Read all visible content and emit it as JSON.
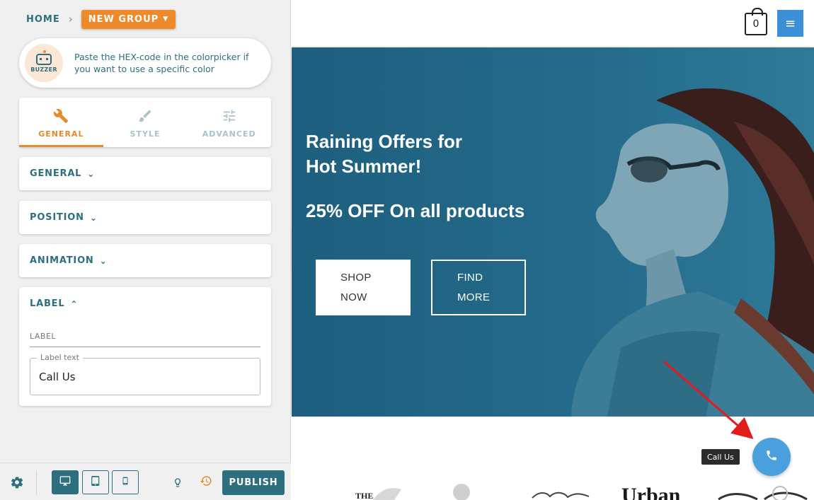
{
  "breadcrumb": {
    "home": "HOME",
    "group": "NEW GROUP"
  },
  "tip": {
    "brand": "BUZZER",
    "text": "Paste the HEX-code in the colorpicker if you want to use a specific color"
  },
  "tabs": [
    {
      "label": "GENERAL",
      "icon": "wrench-icon",
      "active": true
    },
    {
      "label": "STYLE",
      "icon": "brush-icon",
      "active": false
    },
    {
      "label": "ADVANCED",
      "icon": "sliders-icon",
      "active": false
    }
  ],
  "sections": {
    "general": "GENERAL",
    "position": "POSITION",
    "animation": "ANIMATION",
    "label": "LABEL"
  },
  "label_section": {
    "caption": "LABEL",
    "field_legend": "Label text",
    "field_value": "Call Us"
  },
  "footer": {
    "publish": "PUBLISH",
    "active_device": "desktop"
  },
  "site": {
    "cart_count": "0",
    "hero_line1": "Raining Offers for",
    "hero_line2": "Hot Summer!",
    "hero_offer": "25% OFF On all products",
    "btn_shop_1": "SHOP",
    "btn_shop_2": "NOW",
    "btn_find_1": "FIND",
    "btn_find_2": "MORE",
    "logo_the": "THE",
    "logo_urban": "Urban"
  },
  "call_button": {
    "tooltip": "Call Us"
  },
  "colors": {
    "accent_orange": "#ef8a2a",
    "primary_teal": "#2d6f7e",
    "hero_blue": "#246a8a",
    "fab_blue": "#4aa0dc",
    "annotation_red": "#e21b1b"
  }
}
